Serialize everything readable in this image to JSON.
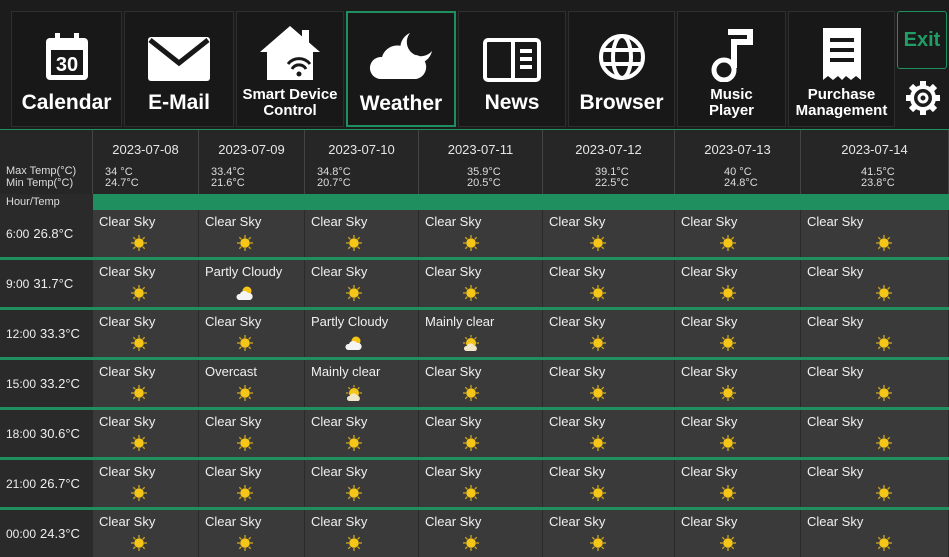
{
  "nav": {
    "buttons": [
      {
        "label": "Calendar",
        "icon": "calendar-icon",
        "cal_day": "30"
      },
      {
        "label": "E-Mail",
        "icon": "envelope-icon"
      },
      {
        "label": "Smart Device Control",
        "icon": "smart-home-icon"
      },
      {
        "label": "Weather",
        "icon": "cloud-moon-icon",
        "active": true
      },
      {
        "label": "News",
        "icon": "newspaper-icon"
      },
      {
        "label": "Browser",
        "icon": "globe-icon"
      },
      {
        "label": "Music Player",
        "icon": "music-note-icon"
      },
      {
        "label": "Purchase Management",
        "icon": "receipt-icon"
      }
    ],
    "exit_label": "Exit",
    "settings_icon": "gear-icon"
  },
  "table": {
    "max_label": "Max Temp(°C)",
    "min_label": "Min Temp(°C)",
    "hour_header": "Hour/Temp",
    "days": [
      {
        "date": "2023-07-08",
        "max": "34  °C",
        "min": "24.7°C"
      },
      {
        "date": "2023-07-09",
        "max": "33.4°C",
        "min": "21.6°C"
      },
      {
        "date": "2023-07-10",
        "max": "34.8°C",
        "min": "20.7°C"
      },
      {
        "date": "2023-07-11",
        "max": "35.9°C",
        "min": "20.5°C"
      },
      {
        "date": "2023-07-12",
        "max": "39.1°C",
        "min": "22.5°C"
      },
      {
        "date": "2023-07-13",
        "max": "40  °C",
        "min": "24.8°C"
      },
      {
        "date": "2023-07-14",
        "max": "41.5°C",
        "min": "23.8°C"
      }
    ],
    "rows": [
      {
        "hour": "6:00",
        "temp": "26.8°C",
        "cells": [
          "Clear Sky",
          "Clear Sky",
          "Clear Sky",
          "Clear Sky",
          "Clear Sky",
          "Clear Sky",
          "Clear Sky"
        ]
      },
      {
        "hour": "9:00",
        "temp": "31.7°C",
        "cells": [
          "Clear Sky",
          "Partly Cloudy",
          "Clear Sky",
          "Clear Sky",
          "Clear Sky",
          "Clear Sky",
          "Clear Sky"
        ]
      },
      {
        "hour": "12:00",
        "temp": "33.3°C",
        "cells": [
          "Clear Sky",
          "Clear Sky",
          "Partly Cloudy",
          "Mainly clear",
          "Clear Sky",
          "Clear Sky",
          "Clear Sky"
        ]
      },
      {
        "hour": "15:00",
        "temp": "33.2°C",
        "cells": [
          "Clear Sky",
          "Overcast",
          "Mainly clear",
          "Clear Sky",
          "Clear Sky",
          "Clear Sky",
          "Clear Sky"
        ]
      },
      {
        "hour": "18:00",
        "temp": "30.6°C",
        "cells": [
          "Clear Sky",
          "Clear Sky",
          "Clear Sky",
          "Clear Sky",
          "Clear Sky",
          "Clear Sky",
          "Clear Sky"
        ]
      },
      {
        "hour": "21:00",
        "temp": "26.7°C",
        "cells": [
          "Clear Sky",
          "Clear Sky",
          "Clear Sky",
          "Clear Sky",
          "Clear Sky",
          "Clear Sky",
          "Clear Sky"
        ]
      },
      {
        "hour": "00:00",
        "temp": "24.3°C",
        "cells": [
          "Clear Sky",
          "Clear Sky",
          "Clear Sky",
          "Clear Sky",
          "Clear Sky",
          "Clear Sky",
          "Clear Sky"
        ]
      }
    ]
  },
  "colors": {
    "accent": "#1f8f5f",
    "sun": "#f5c518"
  }
}
